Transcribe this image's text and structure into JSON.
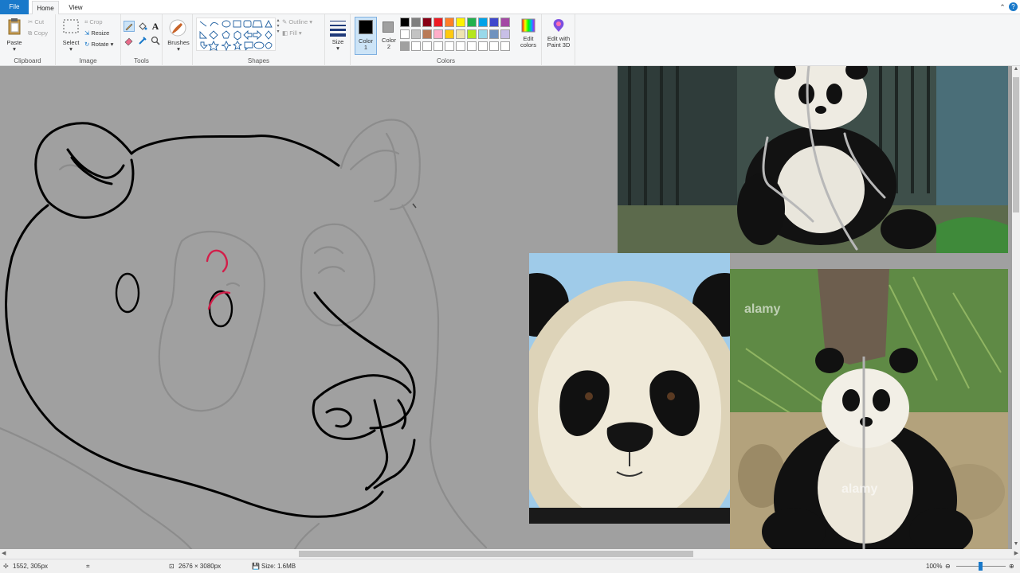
{
  "tabs": {
    "file": "File",
    "home": "Home",
    "view": "View"
  },
  "window": {
    "help_icon": "question-mark-icon"
  },
  "clipboard": {
    "paste": "Paste",
    "cut": "Cut",
    "copy": "Copy",
    "label": "Clipboard"
  },
  "image": {
    "select": "Select",
    "crop": "Crop",
    "resize": "Resize",
    "rotate": "Rotate",
    "label": "Image"
  },
  "tools": {
    "label": "Tools",
    "text_glyph": "A"
  },
  "brushes": {
    "label": "Brushes"
  },
  "shapes": {
    "outline": "Outline",
    "fill": "Fill",
    "label": "Shapes"
  },
  "size": {
    "label": "Size"
  },
  "colors": {
    "color1": "Color\n1",
    "color1_line1": "Color",
    "color1_line2": "1",
    "color2_line1": "Color",
    "color2_line2": "2",
    "edit_line1": "Edit",
    "edit_line2": "colors",
    "paint3d_line1": "Edit with",
    "paint3d_line2": "Paint 3D",
    "label": "Colors",
    "color1_value": "#000000",
    "color2_value": "#a0a0a0",
    "palette_row1": [
      "#000000",
      "#7f7f7f",
      "#880015",
      "#ed1c24",
      "#ff7f27",
      "#fff200",
      "#22b14c",
      "#00a2e8",
      "#3f48cc",
      "#a349a4"
    ],
    "palette_row2": [
      "#ffffff",
      "#c3c3c3",
      "#b97a57",
      "#ffaec9",
      "#ffc90e",
      "#efe4b0",
      "#b5e61d",
      "#99d9ea",
      "#7092be",
      "#c8bfe7"
    ],
    "palette_row3": [
      "#a0a0a0",
      "#ffffff",
      "#ffffff",
      "#ffffff",
      "#ffffff",
      "#ffffff",
      "#ffffff",
      "#ffffff",
      "#ffffff",
      "#ffffff"
    ]
  },
  "status": {
    "cursor_pos": "1552, 305px",
    "dimensions": "2676 × 3080px",
    "file_size": "Size: 1.6MB",
    "zoom": "100%"
  },
  "watermarks": {
    "mark": "alamy"
  }
}
